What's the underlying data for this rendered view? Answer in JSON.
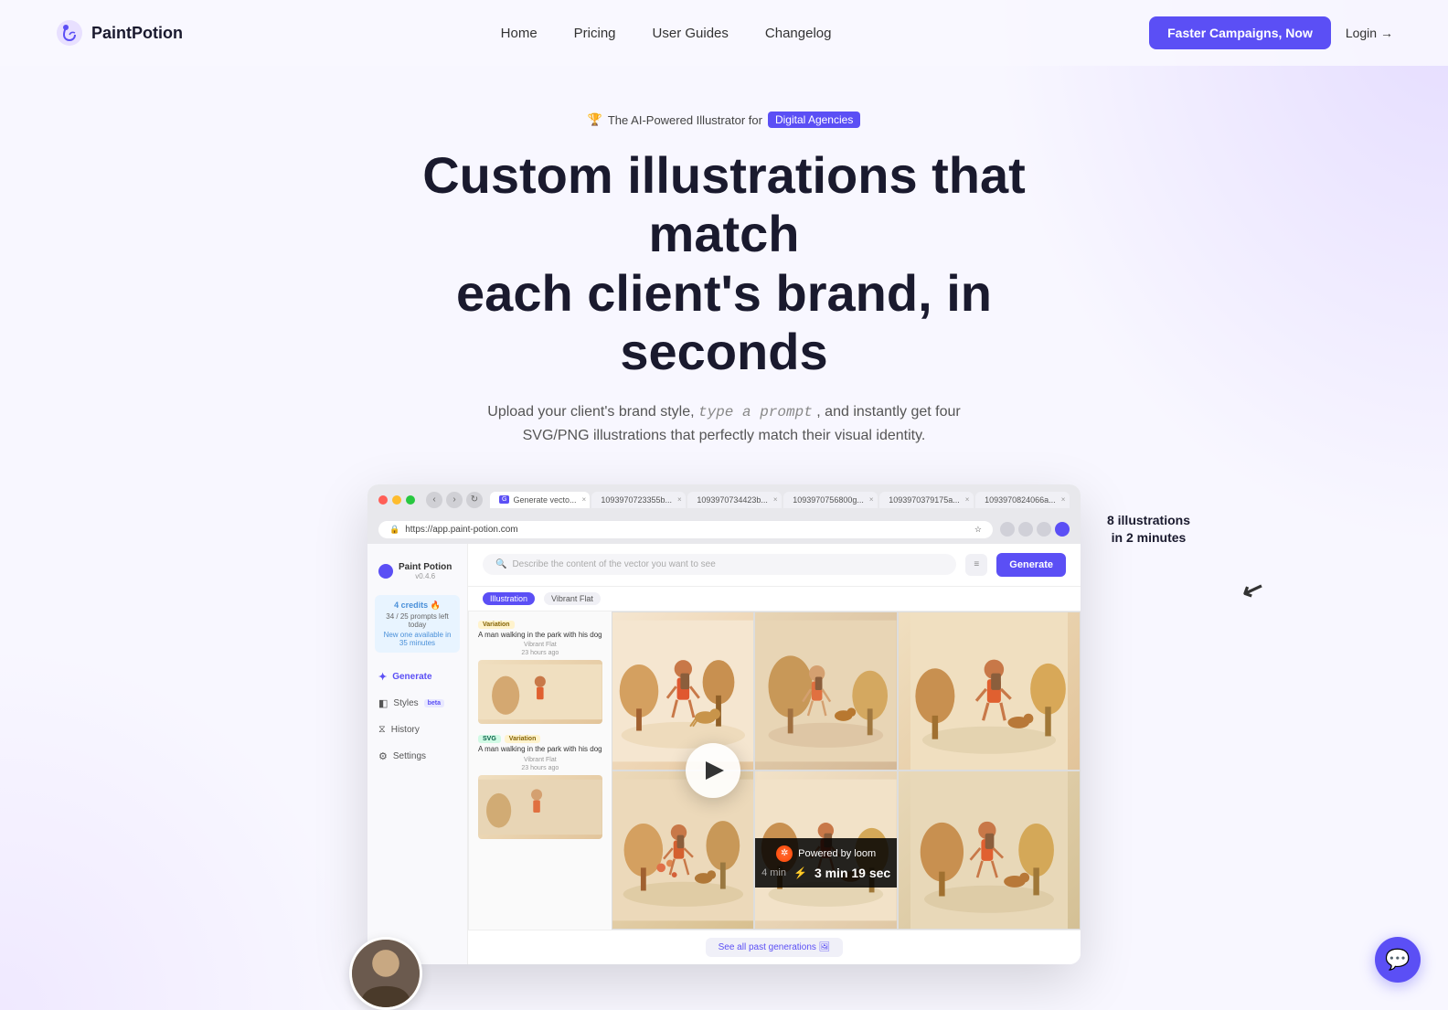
{
  "nav": {
    "logo_text": "PaintPotion",
    "links": [
      {
        "label": "Home",
        "id": "home"
      },
      {
        "label": "Pricing",
        "id": "pricing"
      },
      {
        "label": "User Guides",
        "id": "user-guides"
      },
      {
        "label": "Changelog",
        "id": "changelog"
      }
    ],
    "cta_label": "Faster Campaigns, Now",
    "login_label": "Login →"
  },
  "hero": {
    "badge_prefix": "The AI-Powered Illustrator for",
    "badge_highlight": "Digital Agencies",
    "title_line1": "Custom illustrations that match",
    "title_line2": "each client's brand, in seconds",
    "subtitle_part1": "Upload your client's brand style,",
    "subtitle_code": "type a prompt",
    "subtitle_part2": ", and instantly get four SVG/PNG illustrations that perfectly match their visual identity.",
    "annotation": "8 illustrations\nin 2 minutes"
  },
  "browser": {
    "tabs": [
      {
        "label": "Generate vecto...",
        "active": true
      },
      {
        "label": "1093970723355b..."
      },
      {
        "label": "1093970734423b..."
      },
      {
        "label": "1093970756800g..."
      },
      {
        "label": "1093970379175a..."
      },
      {
        "label": "1093970824066a..."
      }
    ],
    "address": "https://app.paint-potion.com"
  },
  "app": {
    "name": "Paint Potion",
    "version": "v0.4.6",
    "credits_title": "4 credits 🔥",
    "credits_sub": "34 / 25 prompts left today",
    "credits_sub2": "New one available in 35 minutes",
    "sidebar_items": [
      {
        "label": "Generate",
        "icon": "✦",
        "active": true
      },
      {
        "label": "Styles",
        "icon": "◧",
        "beta": true
      },
      {
        "label": "History",
        "icon": "⧖"
      },
      {
        "label": "Settings",
        "icon": "⚙"
      }
    ],
    "search_placeholder": "Describe the content of the vector you want to see",
    "generate_btn": "Generate",
    "filters": [
      "Illustration",
      "Vibrant Flat"
    ],
    "side_panel": [
      {
        "badge": "Variation",
        "description": "A man walking in the park with his dog",
        "style": "Vibrant Flat",
        "time": "23 hours ago"
      },
      {
        "badge": "SVG",
        "badge2": "Variation",
        "description": "A man walking in the park with his dog",
        "style": "Vibrant Flat",
        "time": "23 hours ago"
      }
    ],
    "see_all_btn": "See all past generations 🖼"
  },
  "loom": {
    "powered_text": "Powered by loom",
    "time_secondary": "4 min",
    "time_main": "3 min 19 sec"
  },
  "chat": {
    "icon": "💬"
  }
}
